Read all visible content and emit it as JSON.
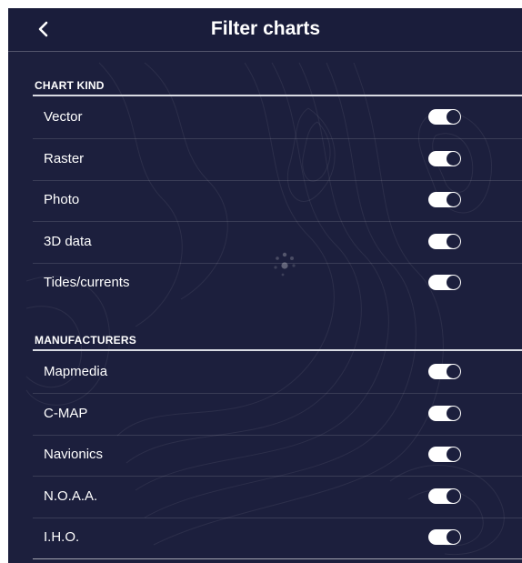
{
  "header": {
    "title": "Filter charts",
    "back_icon": "chevron-left-icon"
  },
  "sections": [
    {
      "title": "CHART KIND",
      "items": [
        {
          "label": "Vector",
          "enabled": true
        },
        {
          "label": "Raster",
          "enabled": true
        },
        {
          "label": "Photo",
          "enabled": true
        },
        {
          "label": "3D data",
          "enabled": true
        },
        {
          "label": "Tides/currents",
          "enabled": true
        }
      ]
    },
    {
      "title": "MANUFACTURERS",
      "items": [
        {
          "label": "Mapmedia",
          "enabled": true
        },
        {
          "label": "C-MAP",
          "enabled": true
        },
        {
          "label": "Navionics",
          "enabled": true
        },
        {
          "label": "N.O.A.A.",
          "enabled": true
        },
        {
          "label": "I.H.O.",
          "enabled": true
        }
      ]
    }
  ],
  "colors": {
    "background": "#1c1f3d",
    "text": "#ffffff",
    "toggle_on": "#ffffff"
  }
}
